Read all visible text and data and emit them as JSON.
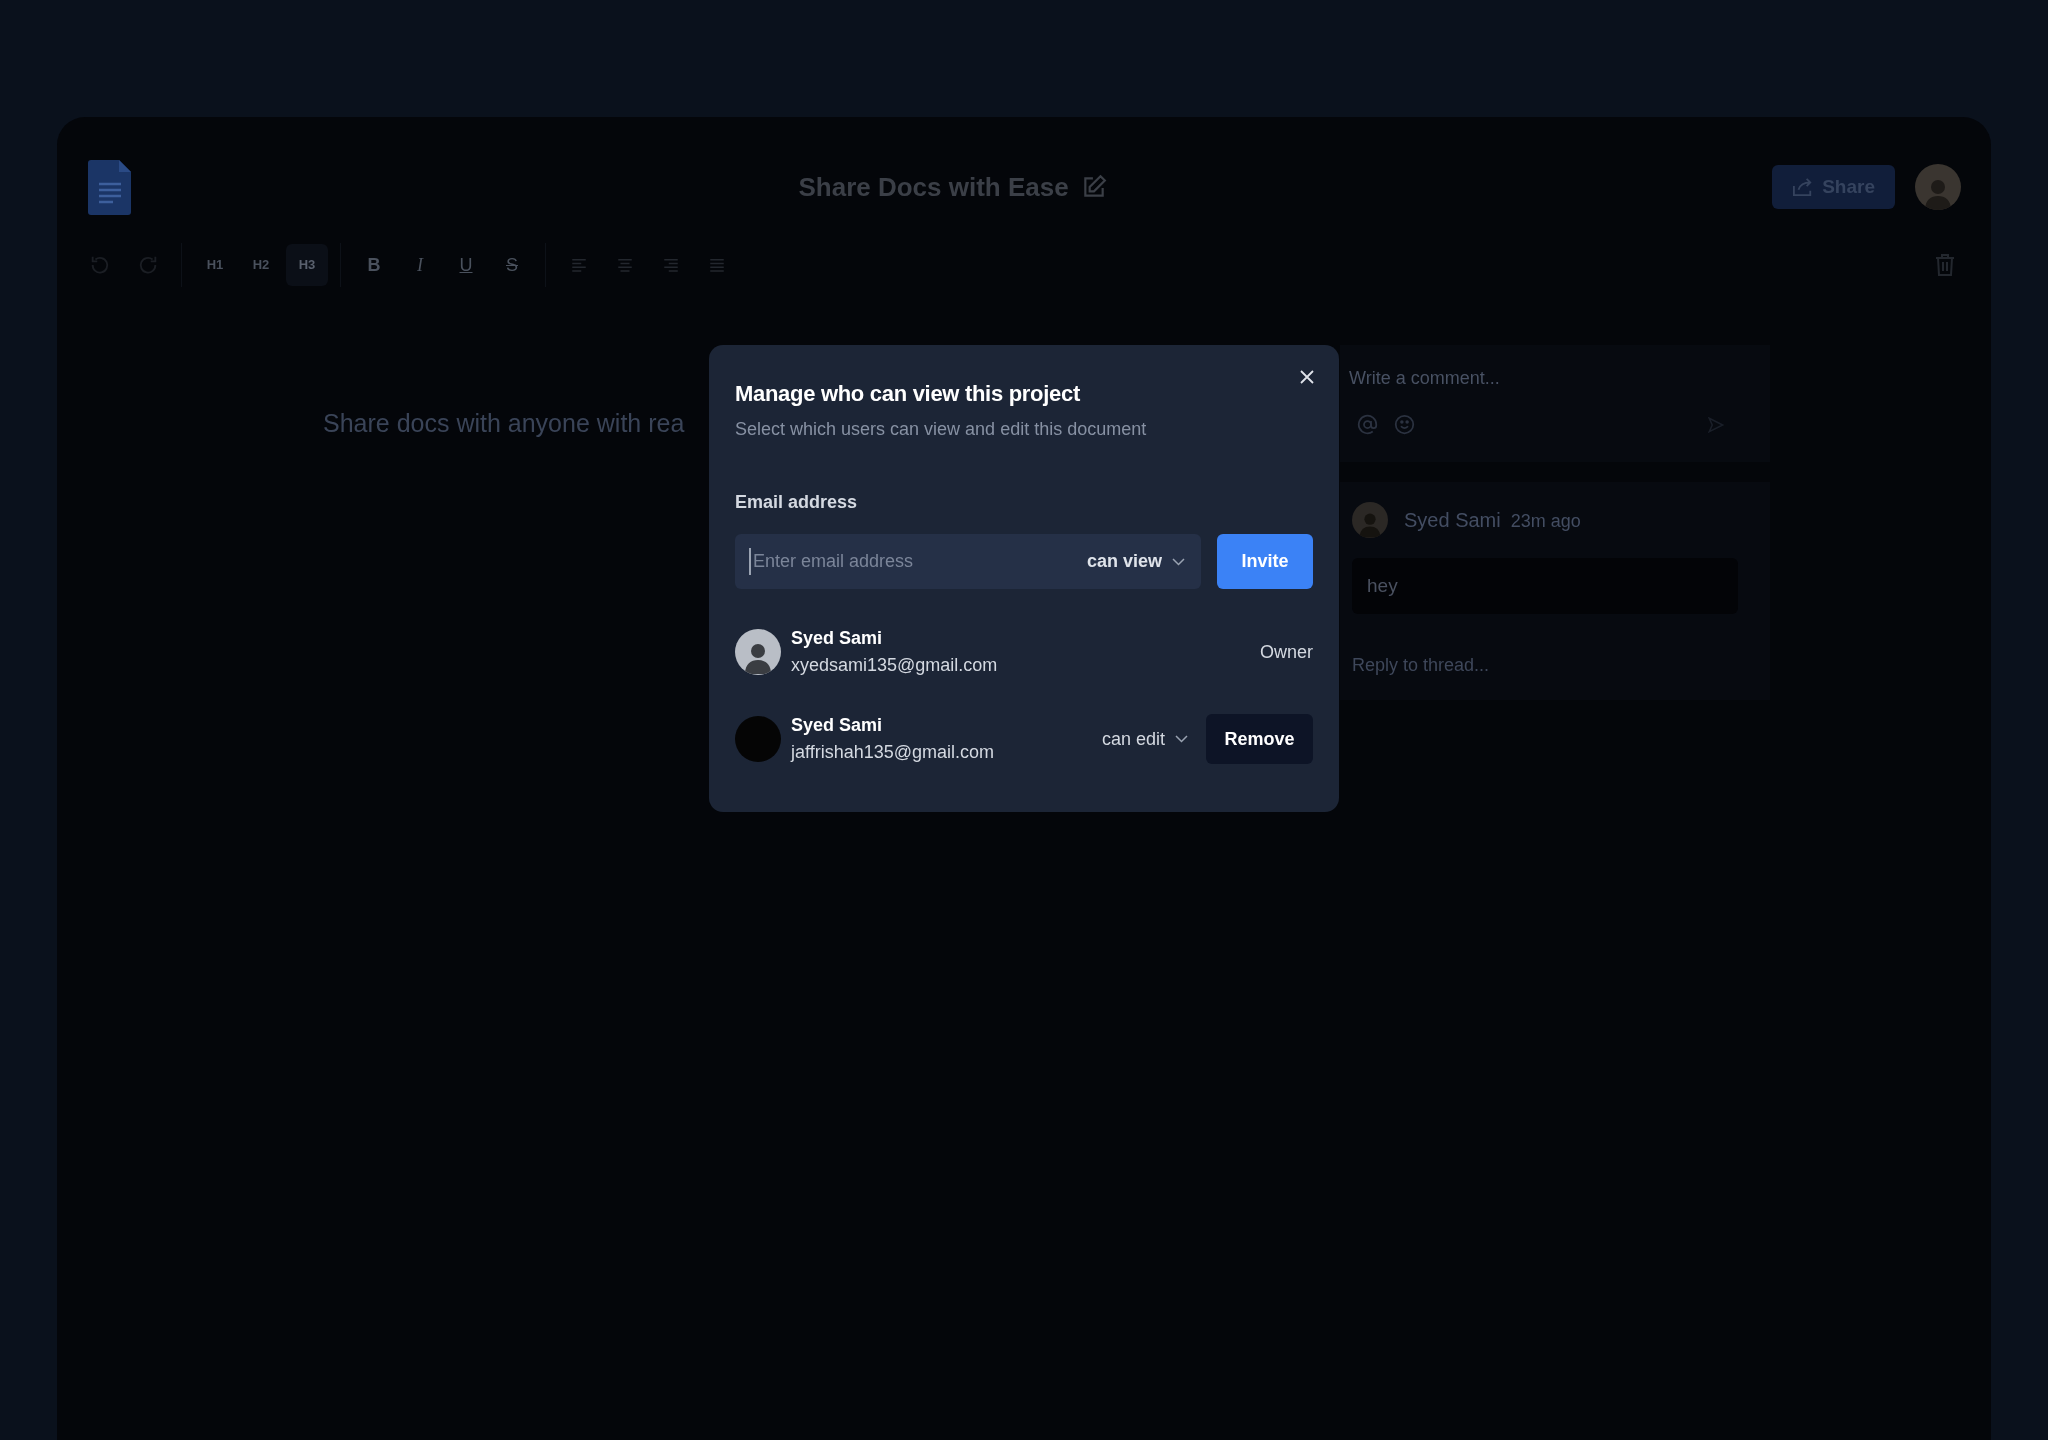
{
  "header": {
    "title": "Share Docs with Ease",
    "share_button": "Share"
  },
  "toolbar": {
    "headings": [
      {
        "label": "H1",
        "selected": false
      },
      {
        "label": "H2",
        "selected": false
      },
      {
        "label": "H3",
        "selected": true
      }
    ],
    "formats": [
      {
        "label": "B",
        "kind": "bold"
      },
      {
        "label": "I",
        "kind": "italic"
      },
      {
        "label": "U",
        "kind": "underline"
      },
      {
        "label": "S",
        "kind": "strike"
      }
    ]
  },
  "editor": {
    "text": "Share docs with anyone with rea"
  },
  "comments": {
    "composer_placeholder": "Write a comment...",
    "thread": {
      "author": "Syed Sami",
      "time": "23m ago",
      "body": "hey",
      "reply_placeholder": "Reply to thread..."
    }
  },
  "dialog": {
    "title": "Manage who can view this project",
    "subtitle": "Select which users can view and edit this document",
    "email_label": "Email address",
    "email_placeholder": "Enter email address",
    "permission": "can view",
    "invite_button": "Invite",
    "members": [
      {
        "kind": "owner",
        "name": "Syed Sami",
        "email": "xyedsami135@gmail.com",
        "role": "Owner"
      },
      {
        "kind": "member",
        "name": "Syed Sami",
        "email": "jaffrishah135@gmail.com",
        "permission": "can edit",
        "action": "Remove"
      }
    ]
  }
}
